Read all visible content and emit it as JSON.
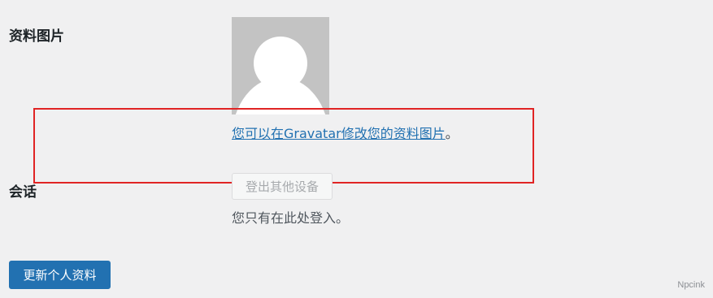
{
  "profile_picture": {
    "label": "资料图片",
    "gravatar_link_text": "您可以在Gravatar修改您的资料图片",
    "gravatar_suffix": "。"
  },
  "sessions": {
    "label": "会话",
    "logout_other_label": "登出其他设备",
    "description": "您只有在此处登入。"
  },
  "submit": {
    "label": "更新个人资料"
  },
  "watermark": "Npcink",
  "colors": {
    "background": "#f0f0f1",
    "link": "#2271b1",
    "primary_button": "#2271b1",
    "highlight_border": "#e02424",
    "avatar_bg": "#c3c3c3"
  }
}
